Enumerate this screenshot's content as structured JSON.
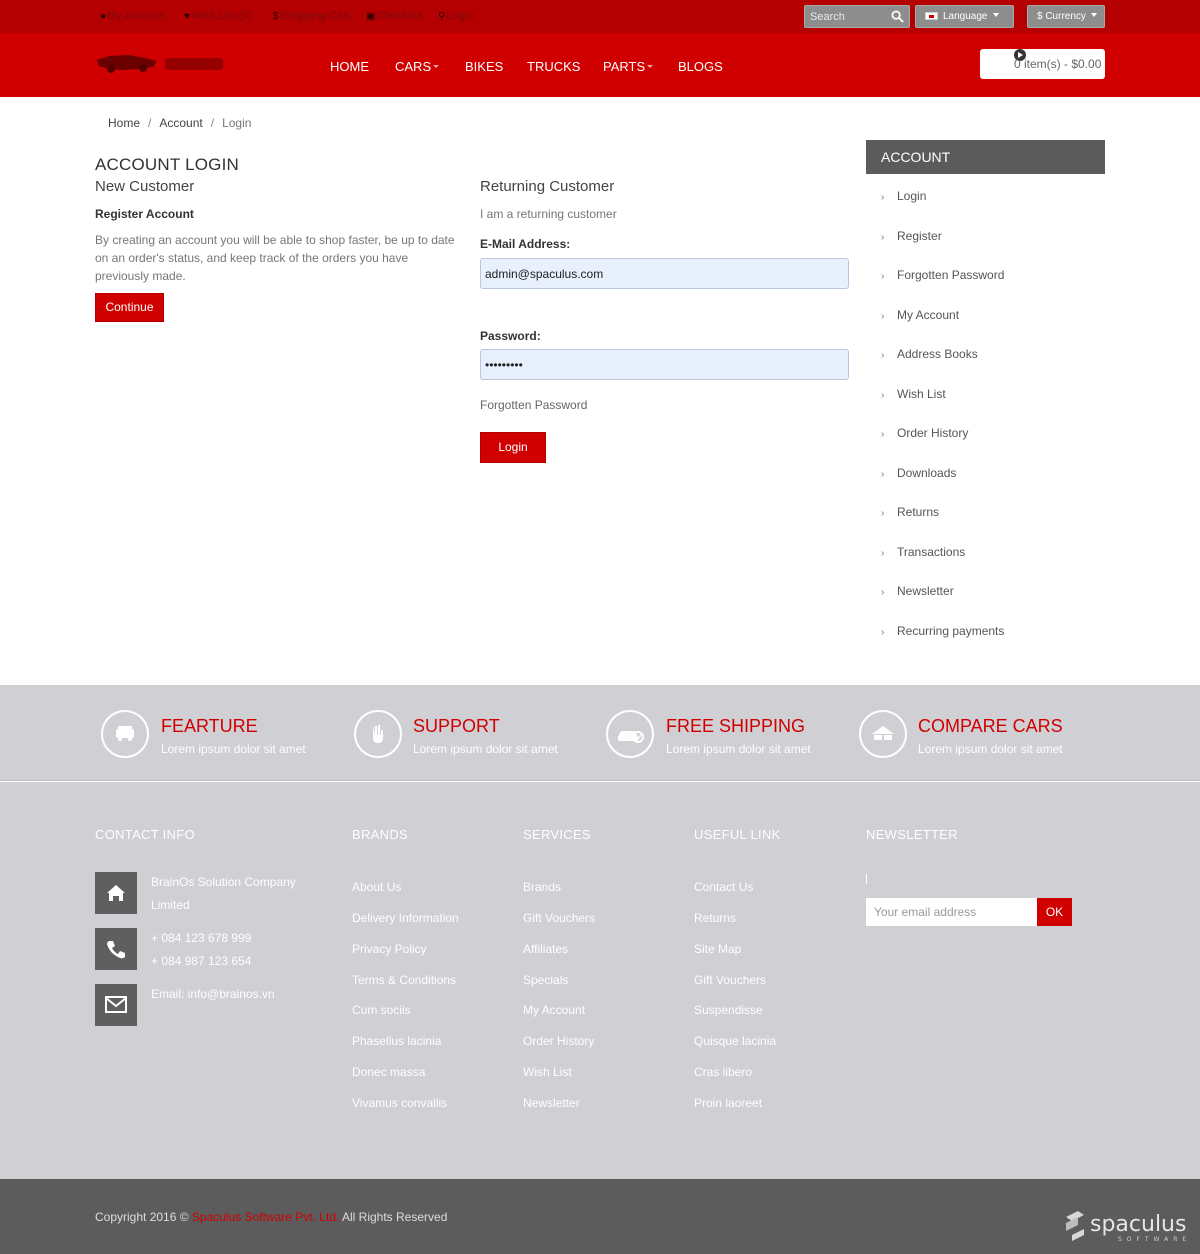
{
  "topbar": {
    "links": [
      {
        "icon": "user-icon",
        "label": "My Account"
      },
      {
        "icon": "heart-icon",
        "label": "Wish List (0)"
      },
      {
        "icon": "dollar-icon",
        "label": "Shopping Cart"
      },
      {
        "icon": "checkout-icon",
        "label": "Checkout"
      },
      {
        "icon": "key-icon",
        "label": "Login"
      }
    ],
    "search_placeholder": "Search",
    "language_label": "Language",
    "currency_label": "$ Currency"
  },
  "header": {
    "nav": [
      "HOME",
      "CARS",
      "BIKES",
      "TRUCKS",
      "PARTS",
      "BLOGS"
    ],
    "cart_label": "0 item(s) - $0.00"
  },
  "breadcrumb": [
    "Home",
    "Account",
    "Login"
  ],
  "main": {
    "title": "ACCOUNT LOGIN",
    "new_customer": {
      "heading": "New Customer",
      "subheading": "Register Account",
      "text": "By creating an account you will be able to shop faster, be up to date on an order's status, and keep track of the orders you have previously made.",
      "button": "Continue"
    },
    "returning": {
      "heading": "Returning Customer",
      "subtext": "I am a returning customer",
      "email_label": "E-Mail Address:",
      "email_value": "admin@spaculus.com",
      "password_label": "Password:",
      "password_value": "•••••••••",
      "forgotten": "Forgotten Password",
      "button": "Login"
    }
  },
  "sidebar": {
    "heading": "ACCOUNT",
    "items": [
      "Login",
      "Register",
      "Forgotten Password",
      "My Account",
      "Address Books",
      "Wish List",
      "Order History",
      "Downloads",
      "Returns",
      "Transactions",
      "Newsletter",
      "Recurring payments"
    ]
  },
  "features": [
    {
      "icon": "car-front-icon",
      "title": "FEARTURE",
      "sub": "Lorem ipsum dolor sit amet"
    },
    {
      "icon": "hand-icon",
      "title": "SUPPORT",
      "sub": "Lorem ipsum dolor sit amet"
    },
    {
      "icon": "car-check-icon",
      "title": "FREE SHIPPING",
      "sub": "Lorem ipsum dolor sit amet"
    },
    {
      "icon": "compare-icon",
      "title": "COMPARE CARS",
      "sub": "Lorem ipsum dolor sit amet"
    }
  ],
  "footer": {
    "contact": {
      "heading": "CONTACT INFO",
      "company": [
        "BrainOs Solution Company",
        "Limited"
      ],
      "phones": [
        "+ 084 123 678 999",
        "+ 084 987 123 654"
      ],
      "email": "Email: info@brainos.vn"
    },
    "brands": {
      "heading": "BRANDS",
      "links": [
        "About Us",
        "Delivery Information",
        "Privacy Policy",
        "Terms & Conditions",
        "Cum sociis",
        "Phasellus lacinia",
        "Donec massa",
        "Vivamus convallis"
      ]
    },
    "services": {
      "heading": "SERVICES",
      "links": [
        "Brands",
        "Gift Vouchers",
        "Affiliates",
        "Specials",
        "My Account",
        "Order History",
        "Wish List",
        "Newsletter"
      ]
    },
    "useful": {
      "heading": "USEFUL LINK",
      "links": [
        "Contact Us",
        "Returns",
        "Site Map",
        "Gift Vouchers",
        "Suspendisse",
        "Quisque lacinia",
        "Cras libero",
        "Proin laoreet"
      ]
    },
    "newsletter": {
      "heading": "NEWSLETTER",
      "placeholder": "Your email address",
      "button": "OK"
    }
  },
  "copyright": {
    "prefix": "Copyright 2016 © ",
    "company": "Spaculus Software Pvt. Ltd.",
    "suffix": " All Rights Reserved"
  },
  "colors": {
    "primary_red": "#d00000",
    "topbar_red": "#b40000",
    "footer_gray": "#cfcfd4",
    "dark_gray": "#5c5c5c"
  }
}
